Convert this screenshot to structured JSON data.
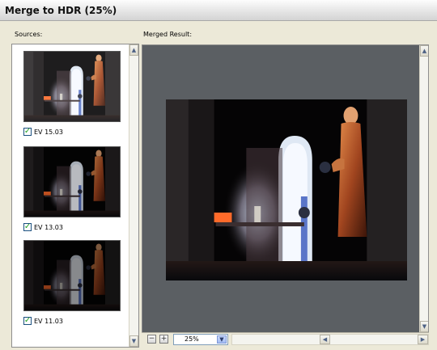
{
  "window": {
    "title": "Merge to HDR (25%)"
  },
  "sources": {
    "label": "Sources:",
    "items": [
      {
        "ev_label": "EV 15.03",
        "checked": true
      },
      {
        "ev_label": "EV 13.03",
        "checked": true
      },
      {
        "ev_label": "EV 11.03",
        "checked": true
      }
    ]
  },
  "result": {
    "label": "Merged Result:"
  },
  "zoom": {
    "value": "25%"
  },
  "icons": {
    "checkbox": "check-mark-icon",
    "zoom_out": "zoom-out-icon",
    "zoom_in": "zoom-in-icon",
    "dropdown": "chevron-down-icon"
  },
  "colors": {
    "checkbox_check": "#21a121",
    "canvas_bg": "#5b5f63"
  }
}
